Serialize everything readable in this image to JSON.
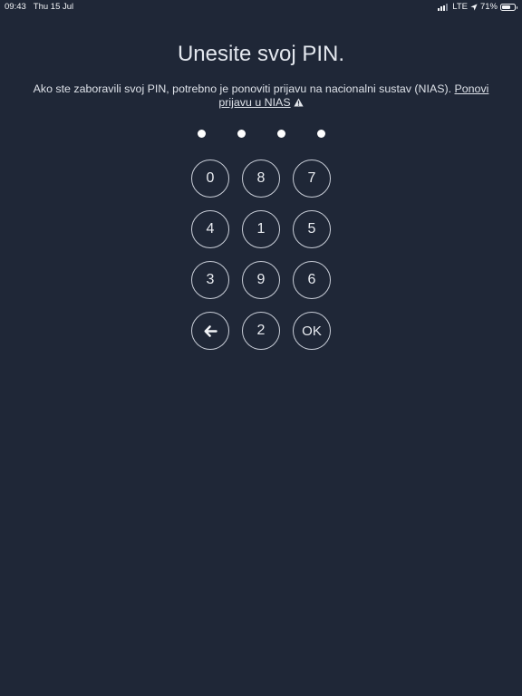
{
  "status_bar": {
    "time": "09:43",
    "date": "Thu 15 Jul",
    "network": "LTE",
    "battery": "71%",
    "battery_level": 0.71
  },
  "title": "Unesite svoj PIN.",
  "message": {
    "text": "Ako ste zaboravili svoj PIN, potrebno je ponoviti prijavu na nacionalni sustav (NIAS). ",
    "link": "Ponovi prijavu u NIAS"
  },
  "pin": {
    "entered": 4
  },
  "keypad": {
    "keys": [
      "0",
      "8",
      "7",
      "4",
      "1",
      "5",
      "3",
      "9",
      "6",
      "back",
      "2",
      "OK"
    ],
    "ok_label": "OK"
  },
  "colors": {
    "background": "#1f2737",
    "text": "#e3e7ee",
    "key_border": "#c9ced8"
  }
}
